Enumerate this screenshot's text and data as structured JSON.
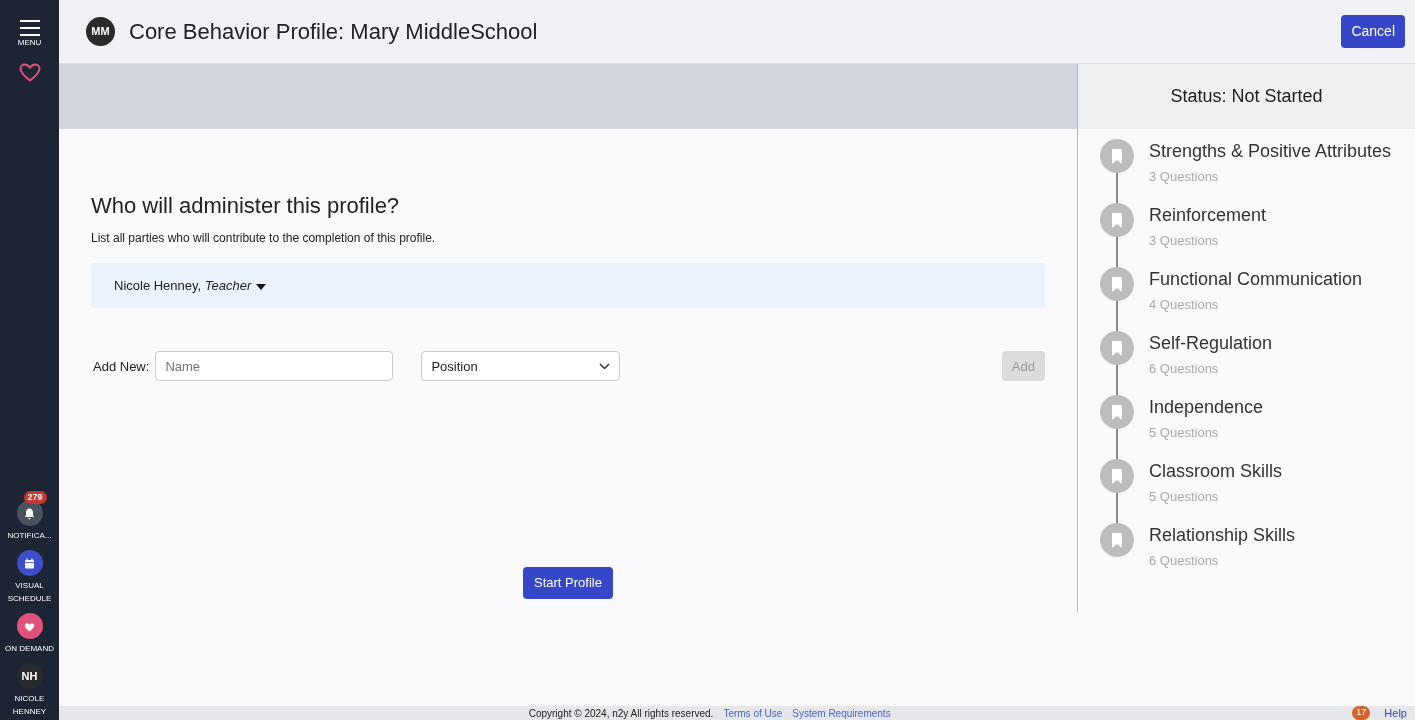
{
  "sidebar": {
    "menu_label": "MENU",
    "items": [
      {
        "kind": "notifications",
        "label": "NOTIFICA...",
        "badge": "279"
      },
      {
        "kind": "schedule",
        "label": "VISUAL SCHEDULE"
      },
      {
        "kind": "ondemand",
        "label": "ON DEMAND"
      },
      {
        "kind": "user",
        "initials": "NH",
        "label": "NICOLE HENNEY"
      }
    ]
  },
  "header": {
    "initials": "MM",
    "title": "Core Behavior Profile: Mary MiddleSchool",
    "cancel": "Cancel"
  },
  "form": {
    "heading": "Who will administer this profile?",
    "description": "List all parties who will contribute to the completion of this profile.",
    "administrators": [
      {
        "name": "Nicole Henney,",
        "role": "Teacher"
      }
    ],
    "add_label": "Add New:",
    "name_placeholder": "Name",
    "position": "Position",
    "add_button": "Add",
    "add_disabled": true,
    "start_button": "Start Profile"
  },
  "status": {
    "title": "Status: Not Started",
    "sections": [
      {
        "title": "Strengths & Positive Attributes",
        "count": "3 Questions"
      },
      {
        "title": "Reinforcement",
        "count": "3 Questions"
      },
      {
        "title": "Functional Communication",
        "count": "4 Questions"
      },
      {
        "title": "Self-Regulation",
        "count": "6 Questions"
      },
      {
        "title": "Independence",
        "count": "5 Questions"
      },
      {
        "title": "Classroom Skills",
        "count": "5 Questions"
      },
      {
        "title": "Relationship Skills",
        "count": "6 Questions"
      }
    ]
  },
  "footer": {
    "copyright": "Copyright © 2024, n2y All rights reserved.",
    "links": [
      "Terms of Use",
      "System Requirements"
    ],
    "help_badge": "17",
    "help": "Help"
  }
}
